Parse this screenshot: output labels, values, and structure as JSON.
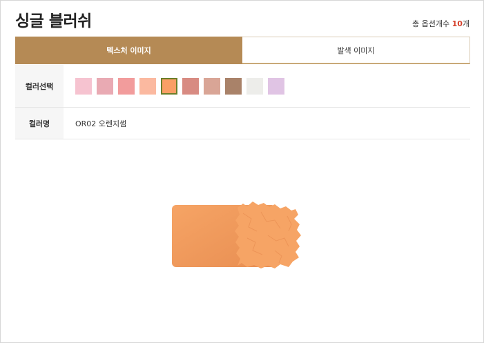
{
  "title": "싱글 블러쉬",
  "option_count": {
    "prefix": "총 옵션개수 ",
    "count": "10",
    "suffix": "개"
  },
  "tabs": [
    {
      "label": "텍스처 이미지",
      "active": true
    },
    {
      "label": "발색 이미지",
      "active": false
    }
  ],
  "color_select": {
    "label": "컬러선택",
    "selected_index": 4,
    "swatches": [
      {
        "color": "#f6c3d0"
      },
      {
        "color": "#e9aab3"
      },
      {
        "color": "#f29c9c"
      },
      {
        "color": "#fbb9a0"
      },
      {
        "color": "#fa9f66"
      },
      {
        "color": "#d88b82"
      },
      {
        "color": "#d9a596"
      },
      {
        "color": "#a98269"
      },
      {
        "color": "#ededea"
      },
      {
        "color": "#e0c4e4"
      }
    ]
  },
  "color_name": {
    "label": "컬러명",
    "value": "OR02 오렌지썸"
  },
  "product_image": {
    "color": "#f6a465",
    "shade_color": "#e88e52"
  }
}
